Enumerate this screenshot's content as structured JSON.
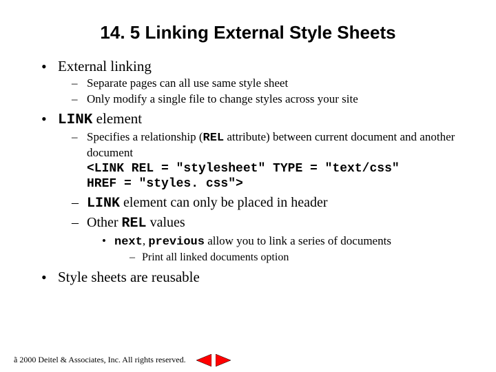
{
  "title": "14. 5 Linking External Style Sheets",
  "bullets": {
    "b1": "External linking",
    "b1_d1": "Separate pages can all use same style sheet",
    "b1_d2": "Only modify a single file to change styles across your site",
    "b2_pre": "LINK",
    "b2_post": " element",
    "b2_d1_a": "Specifies a relationship  (",
    "b2_d1_rel": "REL",
    "b2_d1_b": " attribute) between current document and another document",
    "b2_code_l1": "<LINK REL = \"stylesheet\" TYPE = \"text/css\"",
    "b2_code_l2": " HREF = \"styles. css\">",
    "b2_d2_pre": "LINK",
    "b2_d2_post": " element can only be placed in header",
    "b2_d3_a": "Other ",
    "b2_d3_rel": "REL",
    "b2_d3_b": " values",
    "b2_d3_s1_next": "next",
    "b2_d3_s1_mid": ", ",
    "b2_d3_s1_prev": "previous",
    "b2_d3_s1_rest": " allow you to link a series of documents",
    "b2_d3_s1_d1": "Print all linked documents option",
    "b3": "Style sheets are reusable"
  },
  "footer": "ã 2000 Deitel & Associates, Inc.  All rights reserved."
}
